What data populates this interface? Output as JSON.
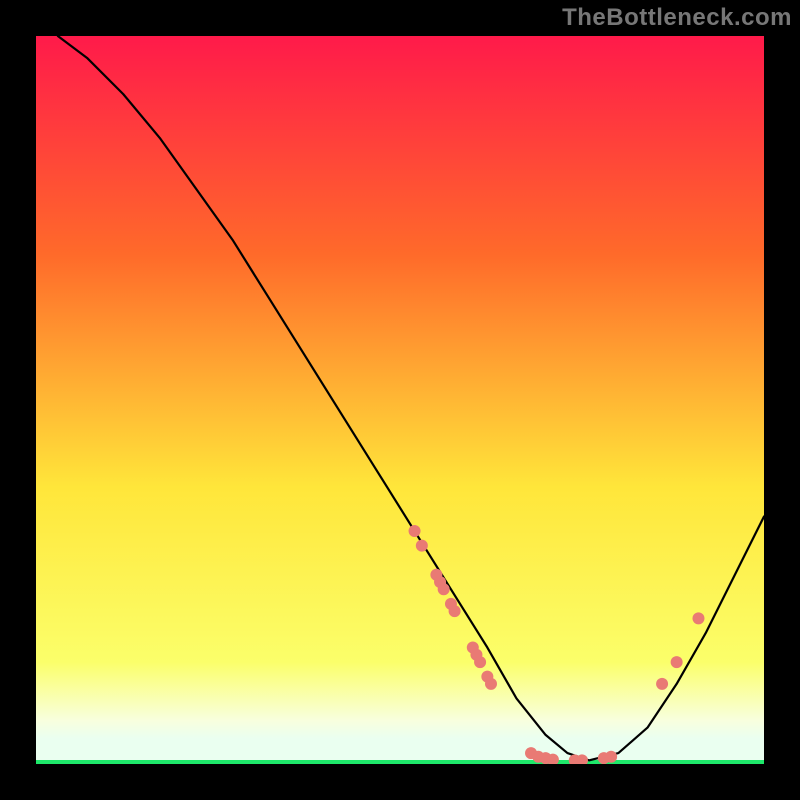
{
  "watermark": "TheBottleneck.com",
  "chart_data": {
    "type": "line",
    "title": "",
    "xlabel": "",
    "ylabel": "",
    "xlim": [
      0,
      100
    ],
    "ylim": [
      0,
      100
    ],
    "grid": false,
    "legend": false,
    "background_gradient": {
      "top": "#ff1a4a",
      "mid_upper": "#ff6a2a",
      "mid": "#ffe63a",
      "mid_lower": "#fbff6a",
      "bottom_band": "#eafff0",
      "bottom_line": "#1ee86a"
    },
    "series": [
      {
        "name": "curve",
        "color": "#000000",
        "x": [
          3,
          7,
          12,
          17,
          22,
          27,
          32,
          37,
          42,
          47,
          52,
          57,
          62,
          66,
          70,
          73,
          76,
          80,
          84,
          88,
          92,
          96,
          100
        ],
        "y": [
          100,
          97,
          92,
          86,
          79,
          72,
          64,
          56,
          48,
          40,
          32,
          24,
          16,
          9,
          4,
          1.5,
          0.5,
          1.5,
          5,
          11,
          18,
          26,
          34
        ]
      }
    ],
    "points": {
      "color": "#e97a74",
      "radius": 6,
      "data": [
        {
          "x": 52,
          "y": 32
        },
        {
          "x": 53,
          "y": 30
        },
        {
          "x": 55,
          "y": 26
        },
        {
          "x": 55.5,
          "y": 25
        },
        {
          "x": 56,
          "y": 24
        },
        {
          "x": 57,
          "y": 22
        },
        {
          "x": 57.5,
          "y": 21
        },
        {
          "x": 60,
          "y": 16
        },
        {
          "x": 60.5,
          "y": 15
        },
        {
          "x": 61,
          "y": 14
        },
        {
          "x": 62,
          "y": 12
        },
        {
          "x": 62.5,
          "y": 11
        },
        {
          "x": 68,
          "y": 1.5
        },
        {
          "x": 69,
          "y": 1
        },
        {
          "x": 70,
          "y": 0.8
        },
        {
          "x": 71,
          "y": 0.6
        },
        {
          "x": 74,
          "y": 0.5
        },
        {
          "x": 75,
          "y": 0.5
        },
        {
          "x": 78,
          "y": 0.8
        },
        {
          "x": 79,
          "y": 1
        },
        {
          "x": 86,
          "y": 11
        },
        {
          "x": 88,
          "y": 14
        },
        {
          "x": 91,
          "y": 20
        }
      ]
    }
  }
}
